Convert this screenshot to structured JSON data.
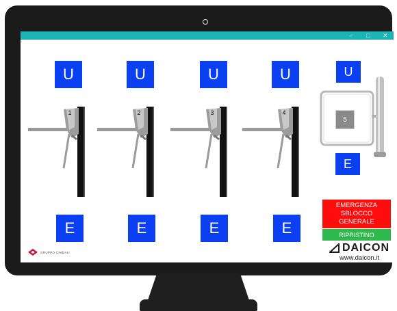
{
  "window": {
    "controls": {
      "minimize": "–",
      "maximize": "□",
      "close": "✕"
    },
    "titlebar_color": "#1cb3b4"
  },
  "gates": [
    {
      "number": "1",
      "entry_label": "U",
      "exit_label": "E"
    },
    {
      "number": "2",
      "entry_label": "U",
      "exit_label": "E"
    },
    {
      "number": "3",
      "entry_label": "U",
      "exit_label": "E"
    },
    {
      "number": "4",
      "entry_label": "U",
      "exit_label": "E"
    },
    {
      "number": "5",
      "entry_label": "U",
      "exit_label": "E"
    }
  ],
  "emergency": {
    "line1": "EMERGENZA",
    "line2": "SBLOCCO GENERALE",
    "color": "#ff0d0d"
  },
  "reset": {
    "label": "RIPRISTINO",
    "color": "#2fb84b"
  },
  "brand": {
    "name": "DAICON",
    "website": "www.daicon.it",
    "logo_icon": "triangle-logo-icon"
  },
  "partner_logo": {
    "text": "GRUPPO CIMBALI",
    "icon": "diamond-logo-icon"
  },
  "colors": {
    "button_blue": "#0a3ff2"
  }
}
